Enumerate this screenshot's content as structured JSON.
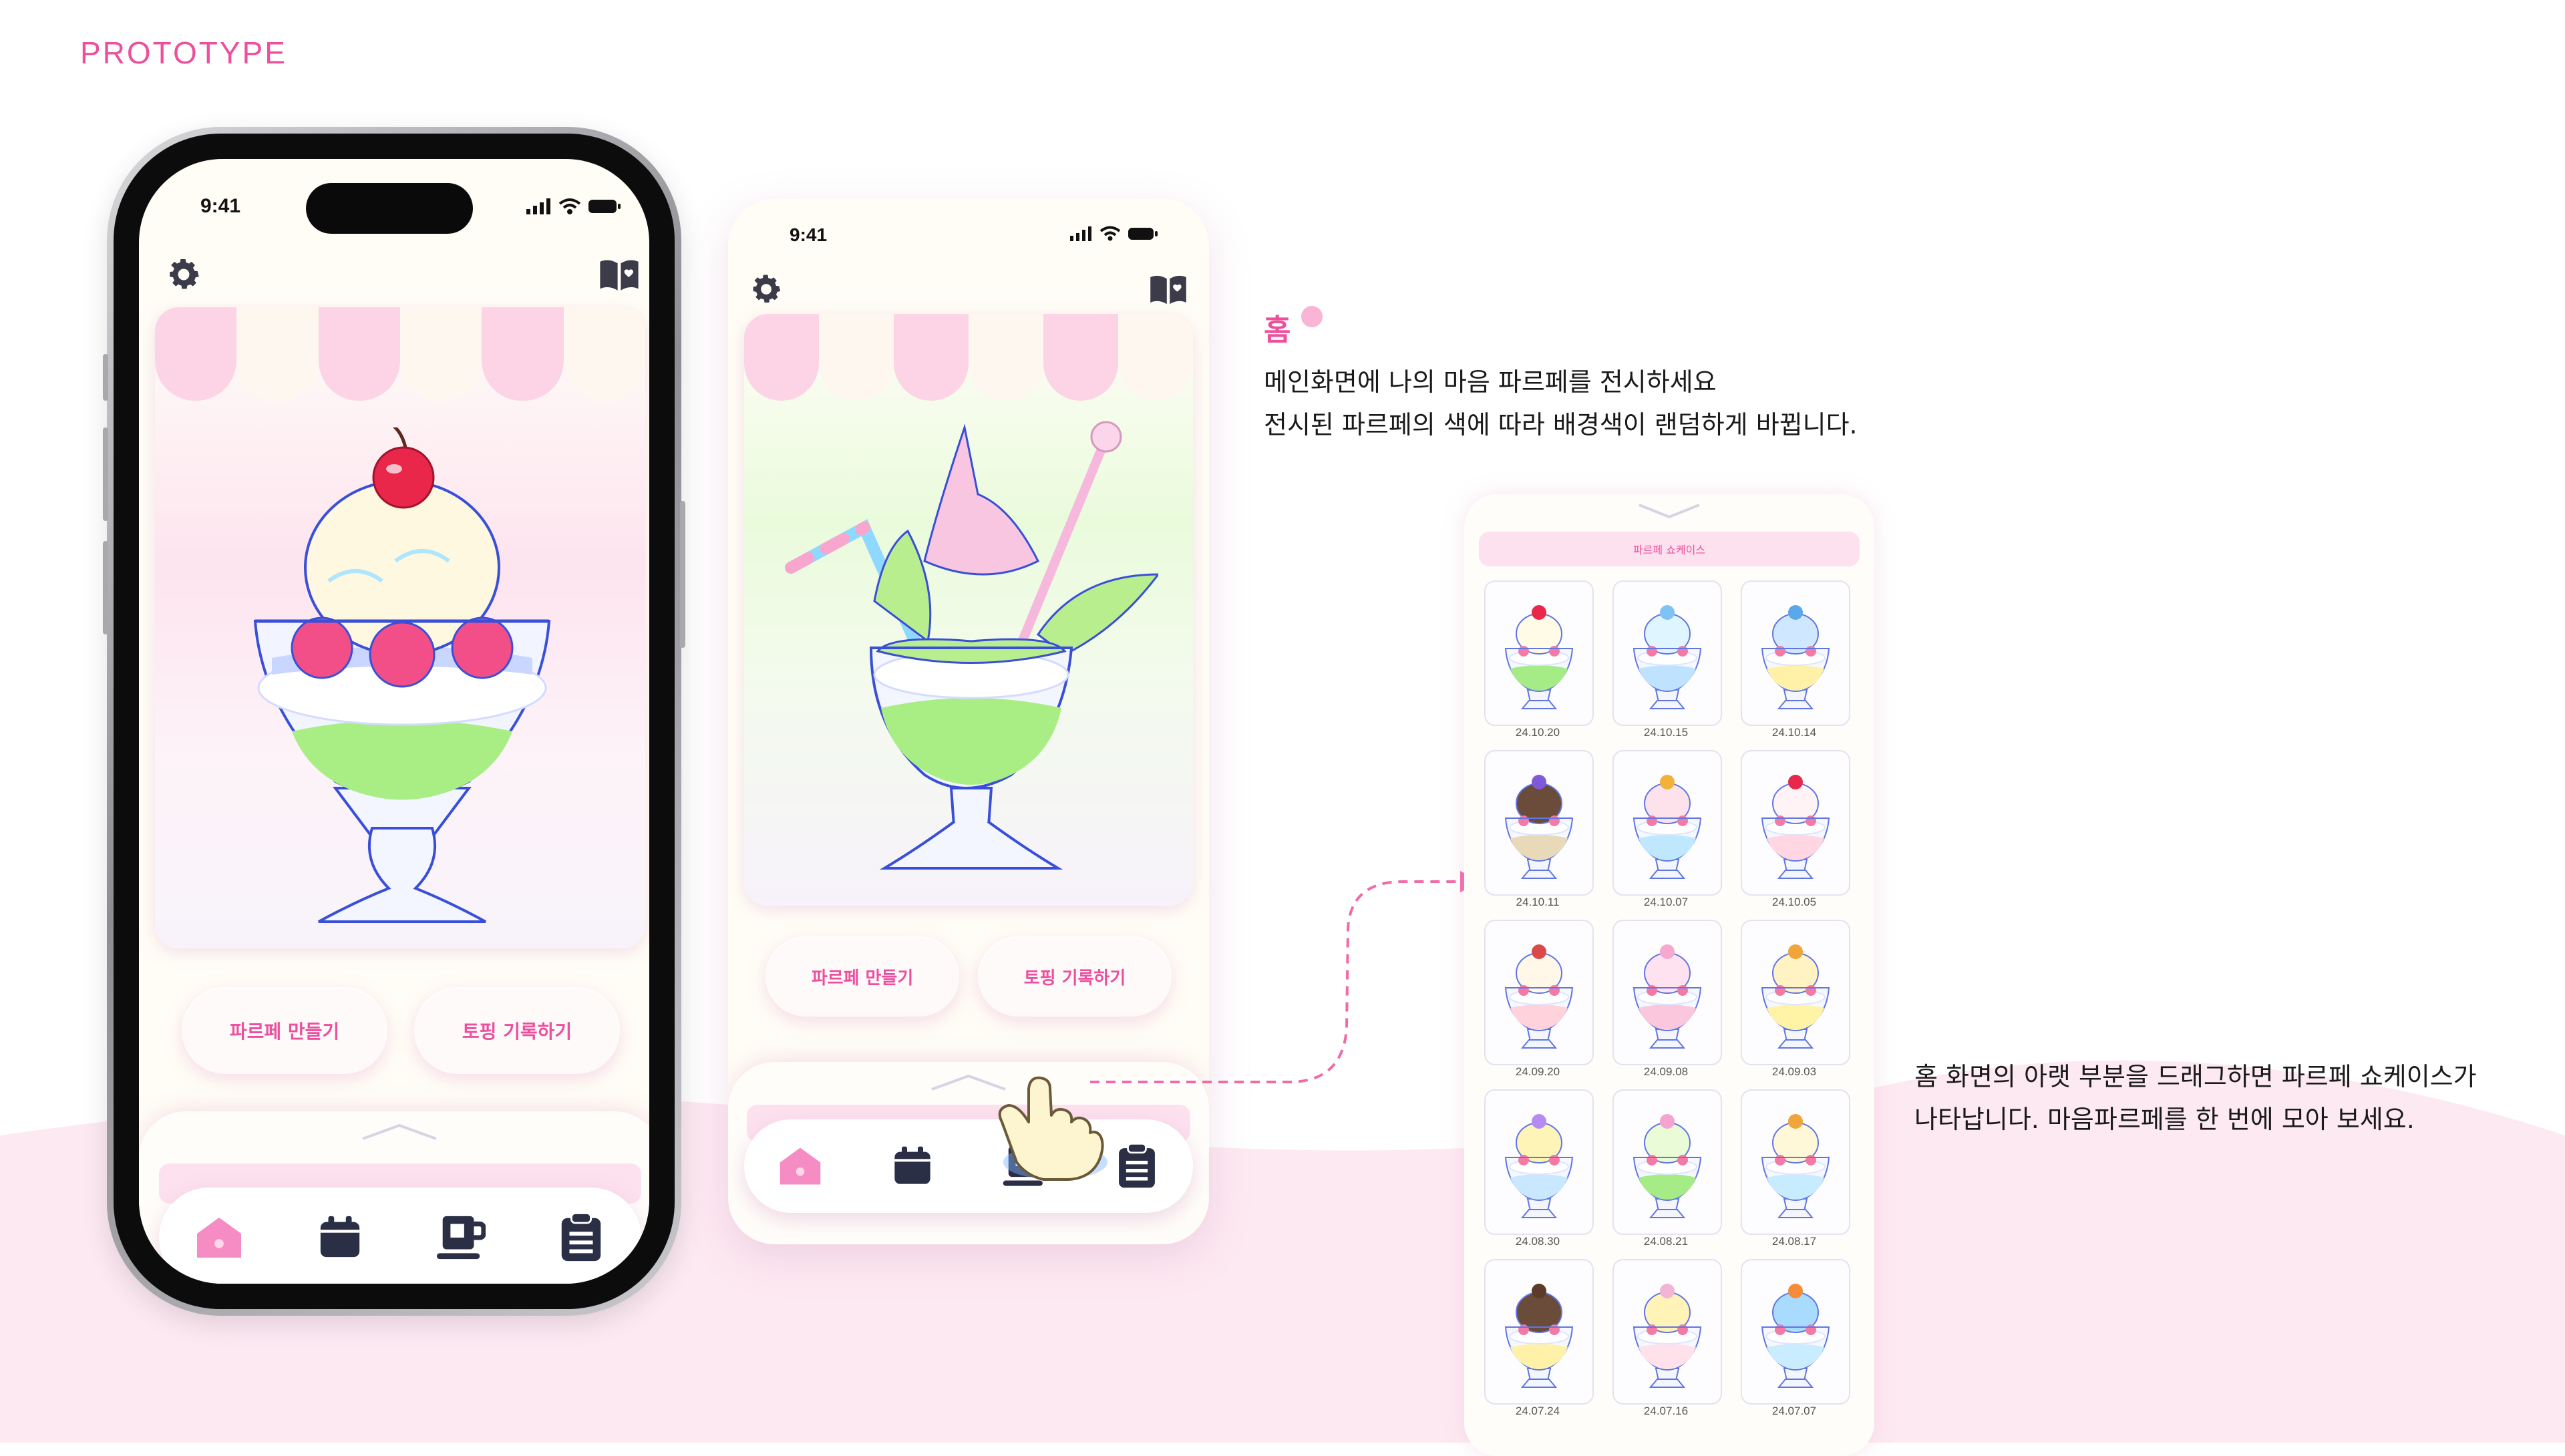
{
  "header": {
    "title": "PROTOTYPE"
  },
  "phone": {
    "time": "9:41",
    "buttons": {
      "make": "파르페 만들기",
      "record": "토핑 기록하기"
    },
    "tabs": [
      "home-icon",
      "calendar-icon",
      "cup-icon",
      "clipboard-icon"
    ]
  },
  "section": {
    "title": "홈",
    "line1": "메인화면에 나의 마음 파르페를 전시하세요",
    "line2": "전시된 파르페의 색에 따라 배경색이 랜덤하게 바뀝니다.",
    "drag_line1": "홈 화면의 아랫 부분을 드래그하면 파르페 쇼케이스가",
    "drag_line2": "나타납니다. 마음파르페를 한 번에 모아 보세요."
  },
  "showcase": {
    "title": "파르페 쇼케이스",
    "items": [
      {
        "date": "24.10.20",
        "cream": "#fffbe6",
        "jelly": "#a5ec86",
        "top": "#e8274a"
      },
      {
        "date": "24.10.15",
        "cream": "#dff5ff",
        "jelly": "#bfe3ff",
        "top": "#7fc3f5"
      },
      {
        "date": "24.10.14",
        "cream": "#cfe8ff",
        "jelly": "#fff2a8",
        "top": "#5aa8ec"
      },
      {
        "date": "24.10.11",
        "cream": "#6b4b3a",
        "jelly": "#e8d9b8",
        "top": "#7f5ad6"
      },
      {
        "date": "24.10.07",
        "cream": "#fde2ec",
        "jelly": "#bfe8ff",
        "top": "#f2b23a"
      },
      {
        "date": "24.10.05",
        "cream": "#fff3f6",
        "jelly": "#ffd6e2",
        "top": "#e8274a"
      },
      {
        "date": "24.09.20",
        "cream": "#fff8e8",
        "jelly": "#ffd2dc",
        "top": "#d94a4a"
      },
      {
        "date": "24.09.08",
        "cream": "#ffe2ef",
        "jelly": "#fbc7dd",
        "top": "#f7a8cf"
      },
      {
        "date": "24.09.03",
        "cream": "#fff3c4",
        "jelly": "#fff3a6",
        "top": "#f0a53a"
      },
      {
        "date": "24.08.30",
        "cream": "#fff4b8",
        "jelly": "#c9e8ff",
        "top": "#b48bf0"
      },
      {
        "date": "24.08.21",
        "cream": "#eafbd8",
        "jelly": "#a5ec86",
        "top": "#f5a3d1"
      },
      {
        "date": "24.08.17",
        "cream": "#fff8d8",
        "jelly": "#c7ebff",
        "top": "#f0a53a"
      },
      {
        "date": "24.07.24",
        "cream": "#6b4b3a",
        "jelly": "#fff2a8",
        "top": "#5b3b2a"
      },
      {
        "date": "24.07.16",
        "cream": "#fff3b8",
        "jelly": "#ffe1ec",
        "top": "#f3b5d5"
      },
      {
        "date": "24.07.07",
        "cream": "#a9dbff",
        "jelly": "#c9ecff",
        "top": "#f58c3a"
      }
    ]
  },
  "colors": {
    "accent": "#ee4f9c",
    "pink_bg": "#fdeaf3",
    "arrow": "#f06aa8"
  }
}
